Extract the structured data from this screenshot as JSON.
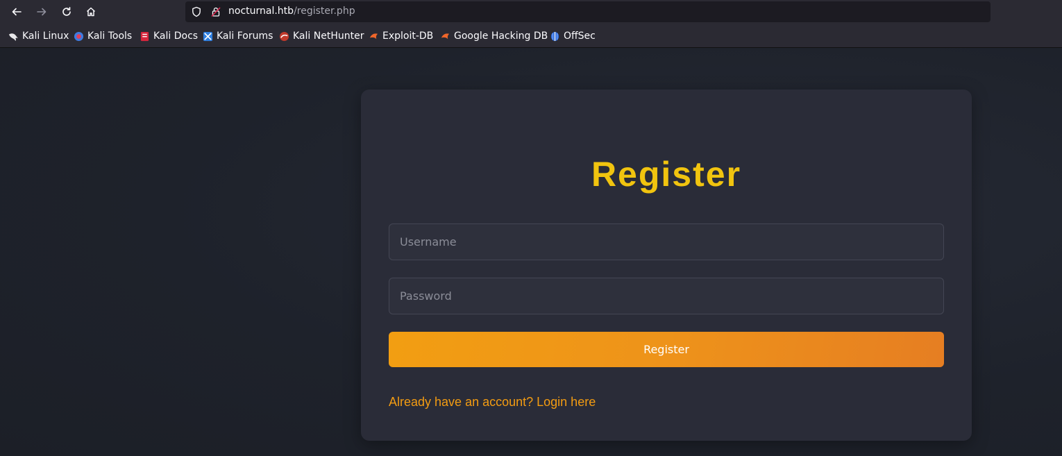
{
  "browser": {
    "url_host": "nocturnal.htb",
    "url_path": "/register.php",
    "bookmarks": [
      {
        "label": "Kali Linux",
        "icon": "kali-dragon-icon"
      },
      {
        "label": "Kali Tools",
        "icon": "kali-tools-icon"
      },
      {
        "label": "Kali Docs",
        "icon": "kali-docs-icon"
      },
      {
        "label": "Kali Forums",
        "icon": "kali-forums-icon"
      },
      {
        "label": "Kali NetHunter",
        "icon": "kali-nethunter-icon"
      },
      {
        "label": "Exploit-DB",
        "icon": "exploit-db-icon"
      },
      {
        "label": "Google Hacking DB",
        "icon": "google-hacking-db-icon"
      },
      {
        "label": "OffSec",
        "icon": "offsec-icon"
      }
    ]
  },
  "form": {
    "title": "Register",
    "username_placeholder": "Username",
    "password_placeholder": "Password",
    "submit_label": "Register",
    "login_link": "Already have an account? Login here"
  },
  "colors": {
    "title": "#f1c40f",
    "button_start": "#f29e12",
    "button_end": "#e67e22",
    "link": "#f39c12",
    "card_bg": "#2a2c38",
    "page_bg": "#1e212a"
  }
}
